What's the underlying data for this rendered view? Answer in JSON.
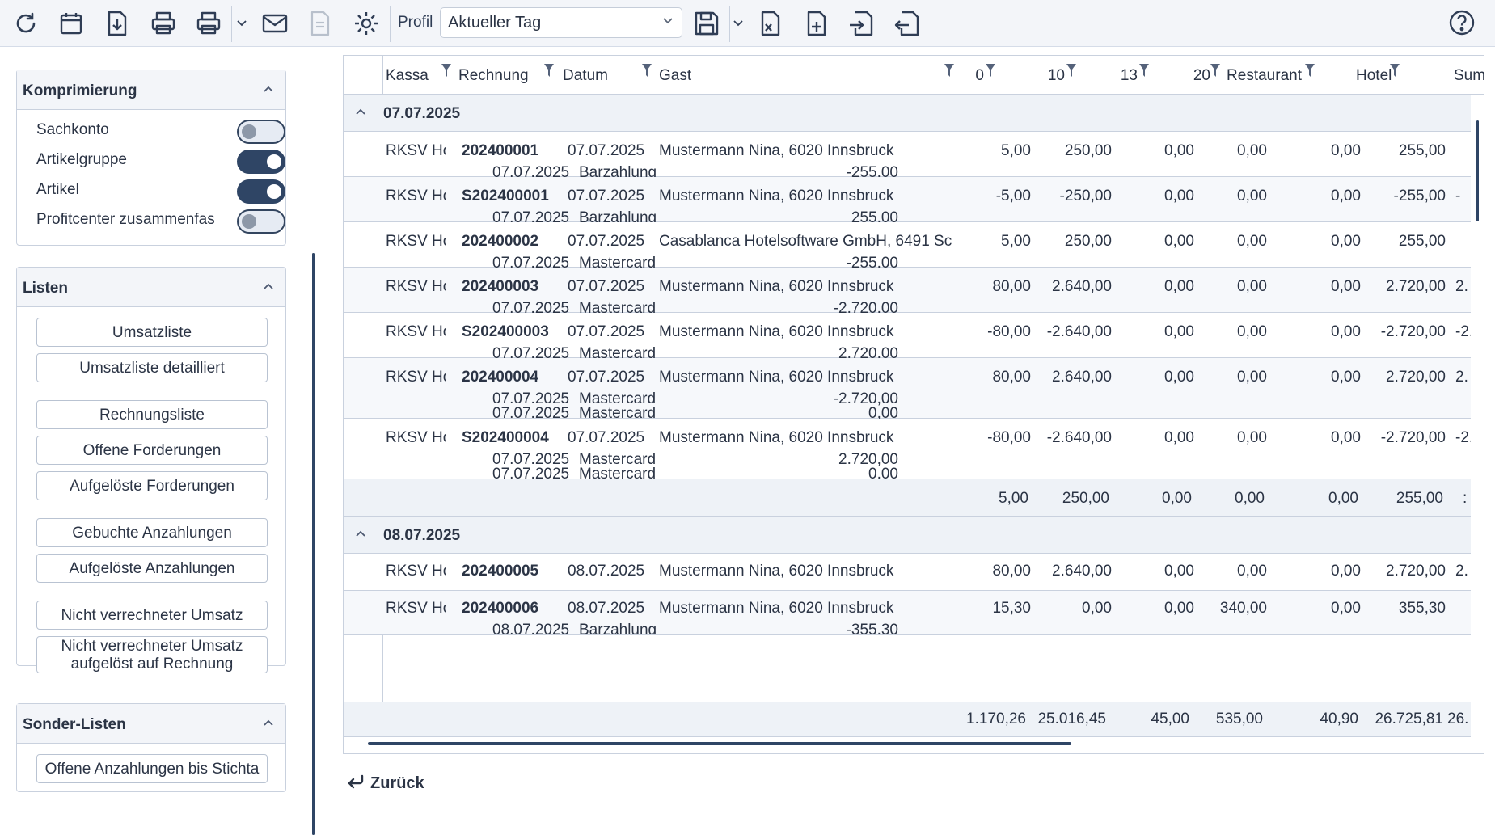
{
  "toolbar": {
    "icons": [
      "refresh-icon",
      "calendar-icon",
      "download-icon",
      "print-icon",
      "print-options-icon",
      "mail-icon",
      "document-icon",
      "settings-icon",
      "save-icon",
      "export-excel-icon",
      "add-document-icon",
      "import-icon",
      "export-icon",
      "help-icon"
    ],
    "profil_label": "Profil",
    "profil_value": "Aktueller Tag"
  },
  "sidebar": {
    "komprimierung": {
      "title": "Komprimierung",
      "options": [
        {
          "label": "Sachkonto",
          "on": false
        },
        {
          "label": "Artikelgruppe",
          "on": true
        },
        {
          "label": "Artikel",
          "on": true
        },
        {
          "label": "Profitcenter zusammenfas",
          "on": false
        }
      ]
    },
    "listen": {
      "title": "Listen",
      "buttons": [
        "Umsatzliste",
        "Umsatzliste detailliert",
        "Rechnungsliste",
        "Offene Forderungen",
        "Aufgelöste Forderungen",
        "Gebuchte Anzahlungen",
        "Aufgelöste Anzahlungen",
        "Nicht verrechneter Umsatz",
        "Nicht verrechneter Umsatz aufgelöst auf Rechnung"
      ]
    },
    "sonder": {
      "title": "Sonder-Listen",
      "buttons": [
        "Offene Anzahlungen bis Stichta"
      ]
    }
  },
  "grid": {
    "columns": [
      "Kassa",
      "Rechnung",
      "Datum",
      "Gast",
      "0",
      "10",
      "13",
      "20",
      "Restaurant",
      "Hotel",
      "Sumr"
    ],
    "groups": [
      {
        "date": "07.07.2025",
        "rows": [
          {
            "kassa": "RKSV Hot",
            "rechnung": "202400001",
            "datum": "07.07.2025",
            "gast": "Mustermann Nina, 6020 Innsbruck",
            "v0": "5,00",
            "v10": "250,00",
            "v13": "0,00",
            "v20": "0,00",
            "rest": "0,00",
            "hotel": "255,00",
            "sum": "",
            "pay": [
              {
                "date": "07.07.2025",
                "type": "Barzahlung",
                "amount": "-255,00"
              }
            ]
          },
          {
            "kassa": "RKSV Hot",
            "rechnung": "S202400001",
            "datum": "07.07.2025",
            "gast": "Mustermann Nina, 6020 Innsbruck",
            "v0": "-5,00",
            "v10": "-250,00",
            "v13": "0,00",
            "v20": "0,00",
            "rest": "0,00",
            "hotel": "-255,00",
            "sum": "-",
            "pay": [
              {
                "date": "07.07.2025",
                "type": "Barzahlung",
                "amount": "255,00"
              }
            ]
          },
          {
            "kassa": "RKSV Hot",
            "rechnung": "202400002",
            "datum": "07.07.2025",
            "gast": "Casablanca Hotelsoftware GmbH, 6491 Sc",
            "v0": "5,00",
            "v10": "250,00",
            "v13": "0,00",
            "v20": "0,00",
            "rest": "0,00",
            "hotel": "255,00",
            "sum": "",
            "pay": [
              {
                "date": "07.07.2025",
                "type": "Mastercard",
                "amount": "-255,00"
              }
            ]
          },
          {
            "kassa": "RKSV Hot",
            "rechnung": "202400003",
            "datum": "07.07.2025",
            "gast": "Mustermann Nina, 6020 Innsbruck",
            "v0": "80,00",
            "v10": "2.640,00",
            "v13": "0,00",
            "v20": "0,00",
            "rest": "0,00",
            "hotel": "2.720,00",
            "sum": "2.",
            "pay": [
              {
                "date": "07.07.2025",
                "type": "Mastercard",
                "amount": "-2.720,00"
              }
            ]
          },
          {
            "kassa": "RKSV Hot",
            "rechnung": "S202400003",
            "datum": "07.07.2025",
            "gast": "Mustermann Nina, 6020 Innsbruck",
            "v0": "-80,00",
            "v10": "-2.640,00",
            "v13": "0,00",
            "v20": "0,00",
            "rest": "0,00",
            "hotel": "-2.720,00",
            "sum": "-2.",
            "pay": [
              {
                "date": "07.07.2025",
                "type": "Mastercard",
                "amount": "2.720,00"
              }
            ]
          },
          {
            "kassa": "RKSV Hot",
            "rechnung": "202400004",
            "datum": "07.07.2025",
            "gast": "Mustermann Nina, 6020 Innsbruck",
            "v0": "80,00",
            "v10": "2.640,00",
            "v13": "0,00",
            "v20": "0,00",
            "rest": "0,00",
            "hotel": "2.720,00",
            "sum": "2.",
            "pay": [
              {
                "date": "07.07.2025",
                "type": "Mastercard",
                "amount": "-2.720,00"
              },
              {
                "date": "07.07.2025",
                "type": "Mastercard",
                "amount": "0,00"
              }
            ]
          },
          {
            "kassa": "RKSV Hot",
            "rechnung": "S202400004",
            "datum": "07.07.2025",
            "gast": "Mustermann Nina, 6020 Innsbruck",
            "v0": "-80,00",
            "v10": "-2.640,00",
            "v13": "0,00",
            "v20": "0,00",
            "rest": "0,00",
            "hotel": "-2.720,00",
            "sum": "-2.",
            "pay": [
              {
                "date": "07.07.2025",
                "type": "Mastercard",
                "amount": "2.720,00"
              },
              {
                "date": "07.07.2025",
                "type": "Mastercard",
                "amount": "0,00"
              }
            ]
          }
        ],
        "subtotal": {
          "v0": "5,00",
          "v10": "250,00",
          "v13": "0,00",
          "v20": "0,00",
          "rest": "0,00",
          "hotel": "255,00",
          "sum": ":"
        }
      },
      {
        "date": "08.07.2025",
        "rows": [
          {
            "kassa": "RKSV Hot",
            "rechnung": "202400005",
            "datum": "08.07.2025",
            "gast": "Mustermann Nina, 6020 Innsbruck",
            "v0": "80,00",
            "v10": "2.640,00",
            "v13": "0,00",
            "v20": "0,00",
            "rest": "0,00",
            "hotel": "2.720,00",
            "sum": "2.",
            "pay": []
          },
          {
            "kassa": "RKSV Hot",
            "rechnung": "202400006",
            "datum": "08.07.2025",
            "gast": "Mustermann Nina, 6020 Innsbruck",
            "v0": "15,30",
            "v10": "0,00",
            "v13": "0,00",
            "v20": "340,00",
            "rest": "0,00",
            "hotel": "355,30",
            "sum": "",
            "pay": [
              {
                "date": "08.07.2025",
                "type": "Barzahlung",
                "amount": "-355,30"
              }
            ]
          }
        ]
      }
    ],
    "total": {
      "v0": "1.170,26",
      "v10": "25.016,45",
      "v13": "45,00",
      "v20": "535,00",
      "rest": "40,90",
      "hotel": "26.725,81",
      "sum": "26."
    }
  },
  "footer": {
    "back_label": "Zurück"
  }
}
